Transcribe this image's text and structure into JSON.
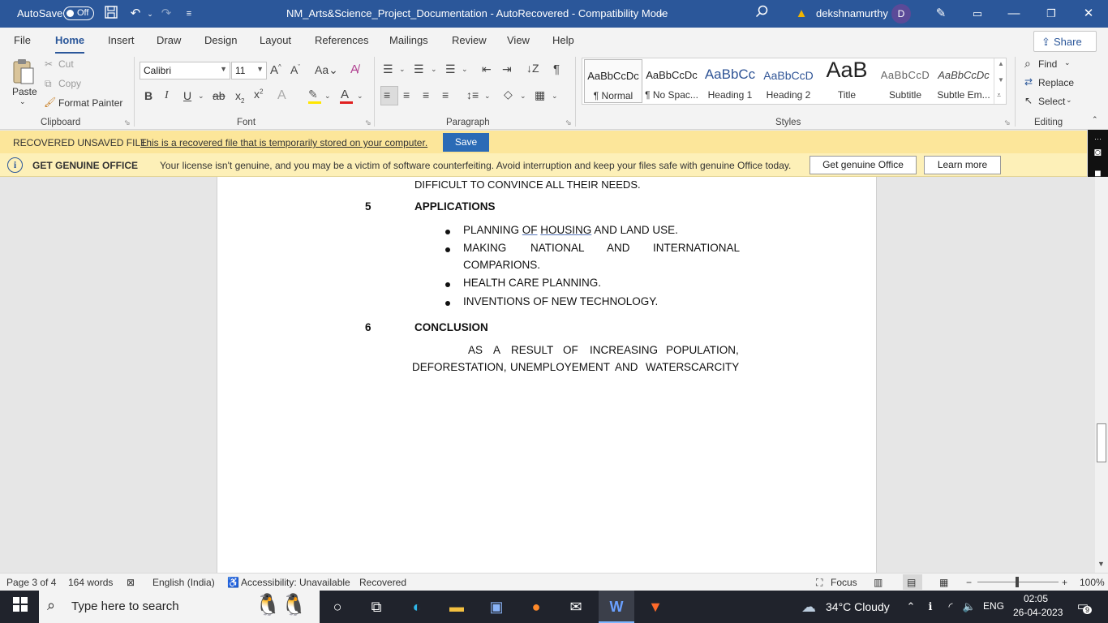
{
  "titlebar": {
    "autosave_label": "AutoSave",
    "autosave_state": "Off",
    "document_title": "NM_Arts&Science_Project_Documentation  -  AutoRecovered  -  Compatibility Mode",
    "user_name": "dekshnamurthy",
    "user_initial": "D"
  },
  "menu": {
    "tabs": [
      "File",
      "Home",
      "Insert",
      "Draw",
      "Design",
      "Layout",
      "References",
      "Mailings",
      "Review",
      "View",
      "Help"
    ],
    "active_tab": "Home",
    "share_label": "Share"
  },
  "ribbon": {
    "clipboard": {
      "paste": "Paste",
      "cut": "Cut",
      "copy": "Copy",
      "format_painter": "Format Painter",
      "group": "Clipboard"
    },
    "font": {
      "name": "Calibri",
      "size": "11",
      "group": "Font"
    },
    "paragraph": {
      "group": "Paragraph"
    },
    "styles": {
      "group": "Styles",
      "items": [
        {
          "preview": "AaBbCcDc",
          "name": "¶ Normal"
        },
        {
          "preview": "AaBbCcDc",
          "name": "¶ No Spac..."
        },
        {
          "preview": "AaBbCc",
          "name": "Heading 1"
        },
        {
          "preview": "AaBbCcD",
          "name": "Heading 2"
        },
        {
          "preview": "AaB",
          "name": "Title"
        },
        {
          "preview": "AaBbCcD",
          "name": "Subtitle"
        },
        {
          "preview": "AaBbCcDc",
          "name": "Subtle Em..."
        }
      ]
    },
    "editing": {
      "find": "Find",
      "replace": "Replace",
      "select": "Select",
      "group": "Editing"
    }
  },
  "recover_bar": {
    "title": "RECOVERED UNSAVED FILE",
    "message": "This is a recovered file that is temporarily stored on your computer.",
    "button": "Save"
  },
  "genuine_bar": {
    "title": "GET GENUINE OFFICE",
    "message": "Your license isn't genuine, and you may be a victim of software counterfeiting. Avoid interruption and keep your files safe with genuine Office today.",
    "button_primary": "Get genuine Office",
    "button_secondary": "Learn more"
  },
  "document": {
    "prev_line": "DIFFICULT TO CONVINCE ALL THEIR NEEDS.",
    "section5": {
      "number": "5",
      "heading": "APPLICATIONS"
    },
    "bullets": {
      "b1_pre": "PLANNING ",
      "b1_u1": "OF",
      "b1_u2": "HOUSING",
      "b1_post": " AND LAND USE.",
      "b2_w1": "MAKING",
      "b2_w2": "NATIONAL",
      "b2_w3": "AND",
      "b2_w4": "INTERNATIONAL",
      "b2_line2": "COMPARIONS.",
      "b3": "HEALTH CARE PLANNING.",
      "b4": "INVENTIONS OF NEW TECHNOLOGY."
    },
    "section6": {
      "number": "6",
      "heading": "CONCLUSION"
    },
    "conclusion_l1": [
      "AS",
      "A",
      "RESULT",
      "OF",
      "INCREASING",
      "POPULATION,"
    ],
    "conclusion_l2": [
      "DEFORESTATION,",
      "UNEMPLOYEMENT",
      "AND",
      "WATER",
      "SCARCITY"
    ]
  },
  "statusbar": {
    "page": "Page 3 of 4",
    "words": "164 words",
    "language": "English (India)",
    "accessibility": "Accessibility: Unavailable",
    "recovered": "Recovered",
    "focus": "Focus",
    "zoom": "100%"
  },
  "taskbar": {
    "search_placeholder": "Type here to search",
    "weather": "34°C  Cloudy",
    "lang": "ENG",
    "time": "02:05",
    "date": "26-04-2023",
    "notif_count": "9"
  },
  "colors": {
    "word_blue": "#2b579a",
    "recover_bar": "#fce69a",
    "genuine_bar": "#fdf0b8",
    "save_button": "#2b6bb6"
  }
}
